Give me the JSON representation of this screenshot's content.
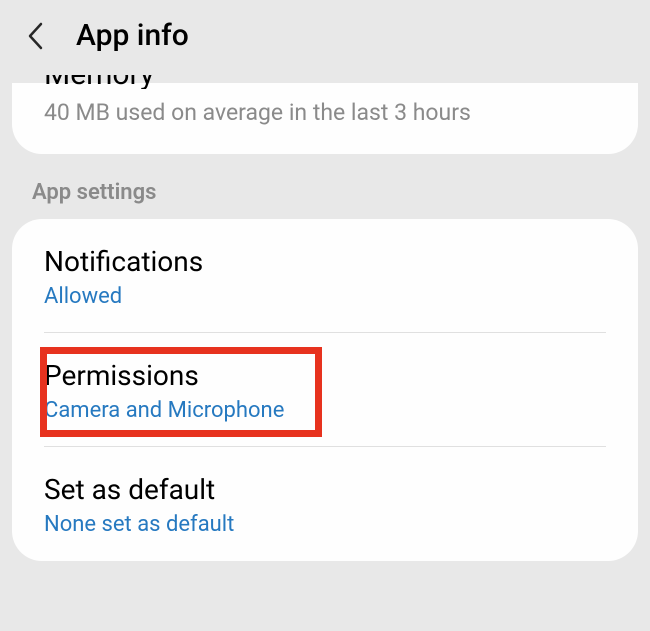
{
  "header": {
    "title": "App info"
  },
  "memory": {
    "title": "Memory",
    "subtitle": "40 MB used on average in the last 3 hours"
  },
  "section_label": "App settings",
  "settings": {
    "notifications": {
      "title": "Notifications",
      "subtitle": "Allowed"
    },
    "permissions": {
      "title": "Permissions",
      "subtitle": "Camera and Microphone"
    },
    "default": {
      "title": "Set as default",
      "subtitle": "None set as default"
    }
  }
}
